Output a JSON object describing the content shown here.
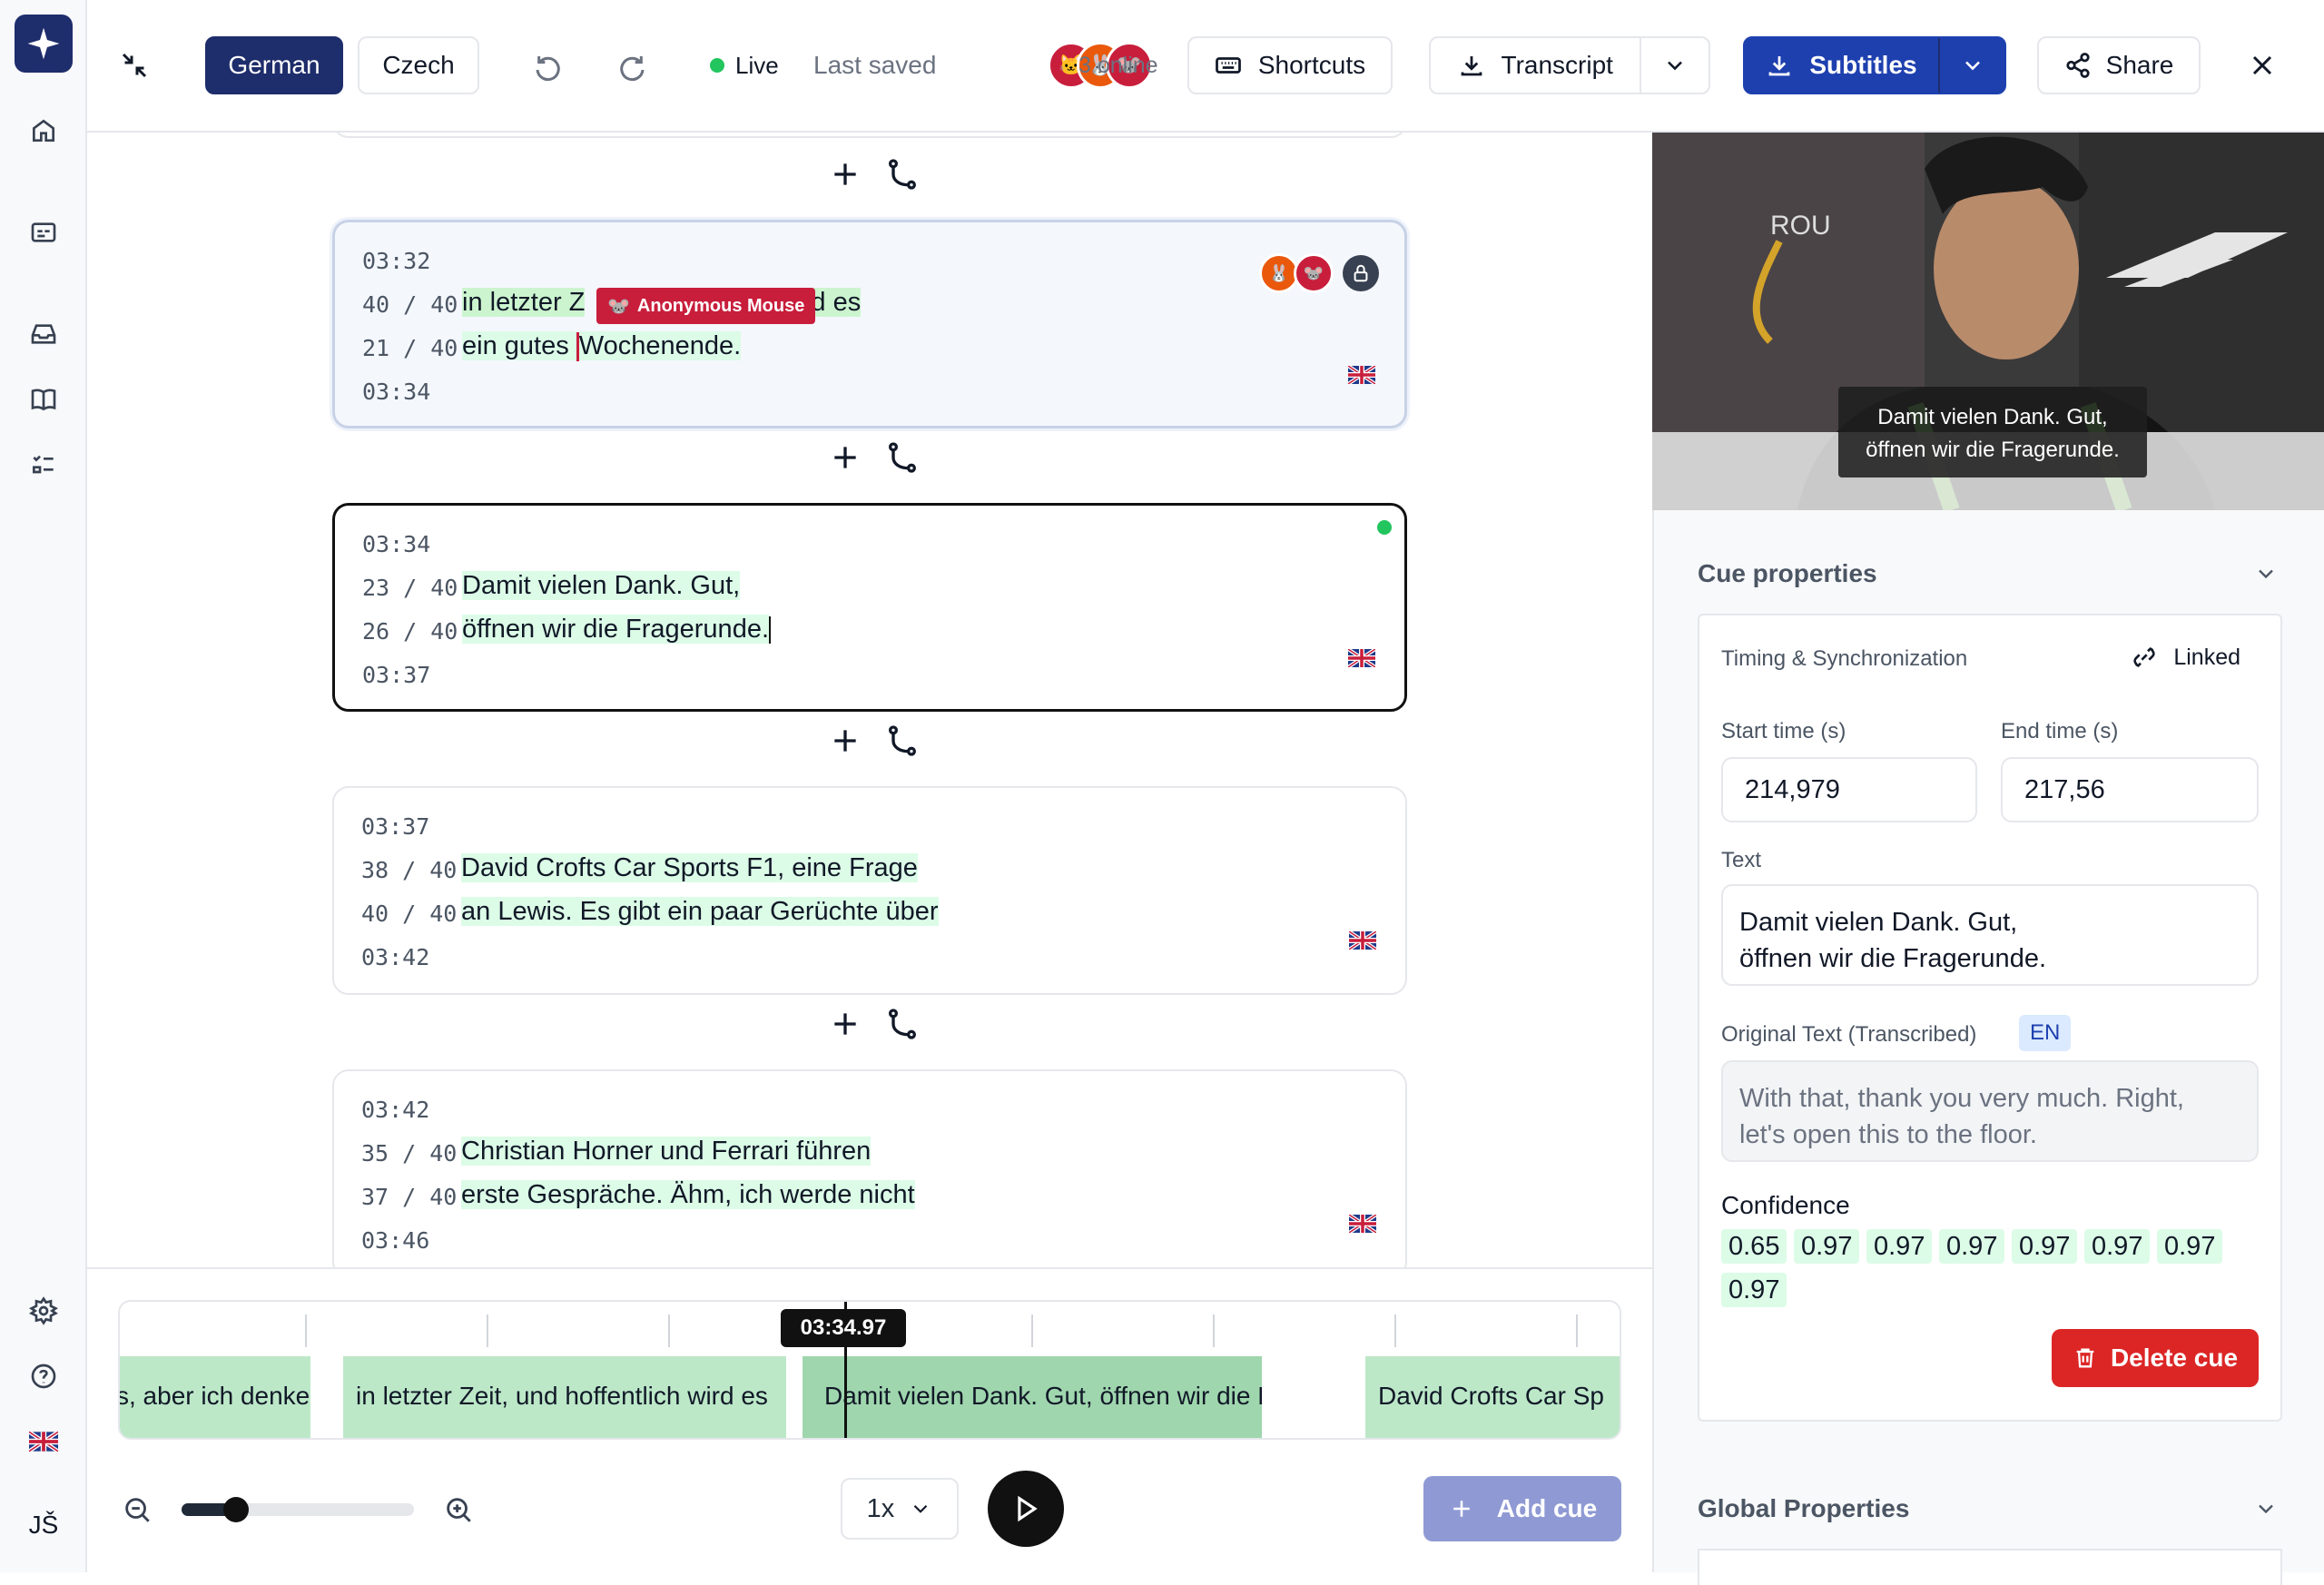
{
  "topbar": {
    "lang_active": "German",
    "lang_other": "Czech",
    "live_label": "Live",
    "last_saved": "Last saved",
    "online": "3 online",
    "shortcuts": "Shortcuts",
    "transcript": "Transcript",
    "subtitles": "Subtitles",
    "share": "Share"
  },
  "cues": [
    {
      "start": "03:32",
      "end": "03:34",
      "count1": "40 / 40",
      "count2": "21 / 40",
      "line1a": "in letzter Z",
      "line1b": "wird es",
      "line2a": "ein gutes ",
      "line2b": "Wochenende.",
      "cursor_user": "Anonymous Mouse"
    },
    {
      "start": "03:34",
      "end": "03:37",
      "count1": "23 / 40",
      "count2": "26 / 40",
      "line1": "Damit vielen Dank. Gut,",
      "line2": "öffnen wir die Fragerunde."
    },
    {
      "start": "03:37",
      "end": "03:42",
      "count1": "38 / 40",
      "count2": "40 / 40",
      "line1": "David Crofts Car Sports F1, eine Frage",
      "line2": "an Lewis. Es gibt ein paar Gerüchte über"
    },
    {
      "start": "03:42",
      "end": "03:46",
      "count1": "35 / 40",
      "count2": "37 / 40",
      "line1": "Christian Horner und Ferrari führen",
      "line2": "erste Gespräche. Ähm, ich werde nicht"
    }
  ],
  "video": {
    "caption1": "Damit vielen Dank. Gut,",
    "caption2": "öffnen wir die Fragerunde."
  },
  "props": {
    "cue_properties": "Cue properties",
    "timing_title": "Timing & Synchronization",
    "linked": "Linked",
    "start_label": "Start time (s)",
    "end_label": "End time (s)",
    "start_value": "214,979",
    "end_value": "217,56",
    "text_label": "Text",
    "text_line1": "Damit vielen Dank. Gut,",
    "text_line2": "öffnen wir die Fragerunde.",
    "orig_label": "Original Text (Transcribed)",
    "orig_lang": "EN",
    "orig_line1": "With that, thank you very much. Right,",
    "orig_line2": "let's open this to the floor.",
    "confidence_label": "Confidence",
    "confidence": [
      "0.65",
      "0.97",
      "0.97",
      "0.97",
      "0.97",
      "0.97",
      "0.97",
      "0.97"
    ],
    "delete": "Delete cue",
    "global": "Global Properties"
  },
  "timeline": {
    "playhead": "03:34.97",
    "seg1": "s, aber ich denke,",
    "seg2": "in letzter Zeit, und hoffentlich wird es",
    "seg3": "Damit vielen Dank. Gut, öffnen wir die F",
    "seg4": "David Crofts Car Sp",
    "speed": "1x",
    "add_cue": "Add cue"
  },
  "user_initials": "JŠ",
  "colors": {
    "brand": "#1e2d6b",
    "live": "#22c55e",
    "highlight": "#dcfce7",
    "delete": "#dc2626",
    "user_tag": "#c81e3c"
  }
}
